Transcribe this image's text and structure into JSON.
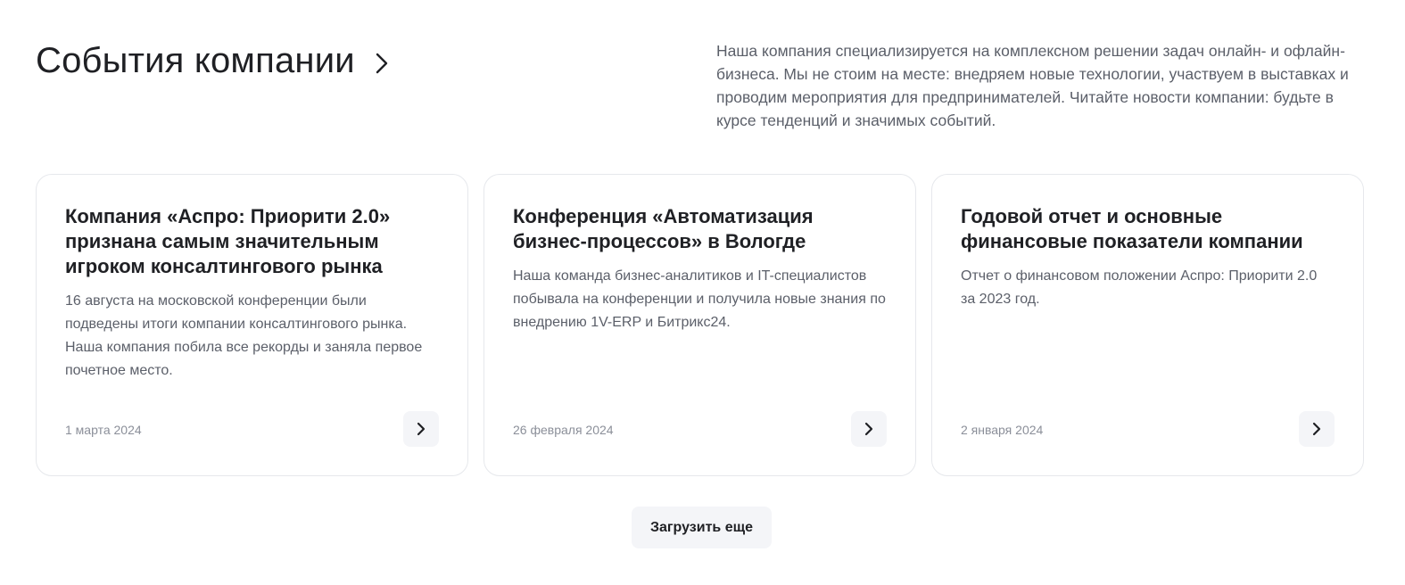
{
  "header": {
    "title": "События компании",
    "chevron_icon": "chevron-right-icon"
  },
  "intro": {
    "text": "Наша компания специализируется на комплексном решении задач онлайн- и офлайн-бизнеса. Мы не стоим на месте: внедряем новые технологии, участвуем в выставках и проводим мероприятия для предпринимателей. Читайте новости компании: будьте в курсе тенденций и значимых событий."
  },
  "cards": [
    {
      "title": "Компания «Аспро: Приорити 2.0» признана самым значительным игроком консалтингового рынка",
      "text": "16 августа на московской конференции были подведены итоги компании консалтингового рынка. Наша компания побила все рекорды и заняла первое почетное место.",
      "date": "1 марта 2024",
      "arrow_icon": "chevron-right-icon"
    },
    {
      "title": "Конференция «Автоматизация бизнес-процессов» в Вологде",
      "text": "Наша команда бизнес-аналитиков и IT-специалистов побывала на конференции и получила новые знания по внедрению 1V-ERP и Битрикс24.",
      "date": "26 февраля 2024",
      "arrow_icon": "chevron-right-icon"
    },
    {
      "title": "Годовой отчет и основные финансовые показатели компании",
      "text": "Отчет о финансовом положении Аспро: Приорити 2.0 за 2023 год.",
      "date": "2 января 2024",
      "arrow_icon": "chevron-right-icon"
    }
  ],
  "load_more": {
    "label": "Загрузить еще"
  },
  "colors": {
    "text_primary": "#1f2024",
    "text_secondary": "#5b5f69",
    "text_muted": "#8b8f99",
    "card_border": "#e6e8ec",
    "button_bg": "#f4f5f8"
  }
}
